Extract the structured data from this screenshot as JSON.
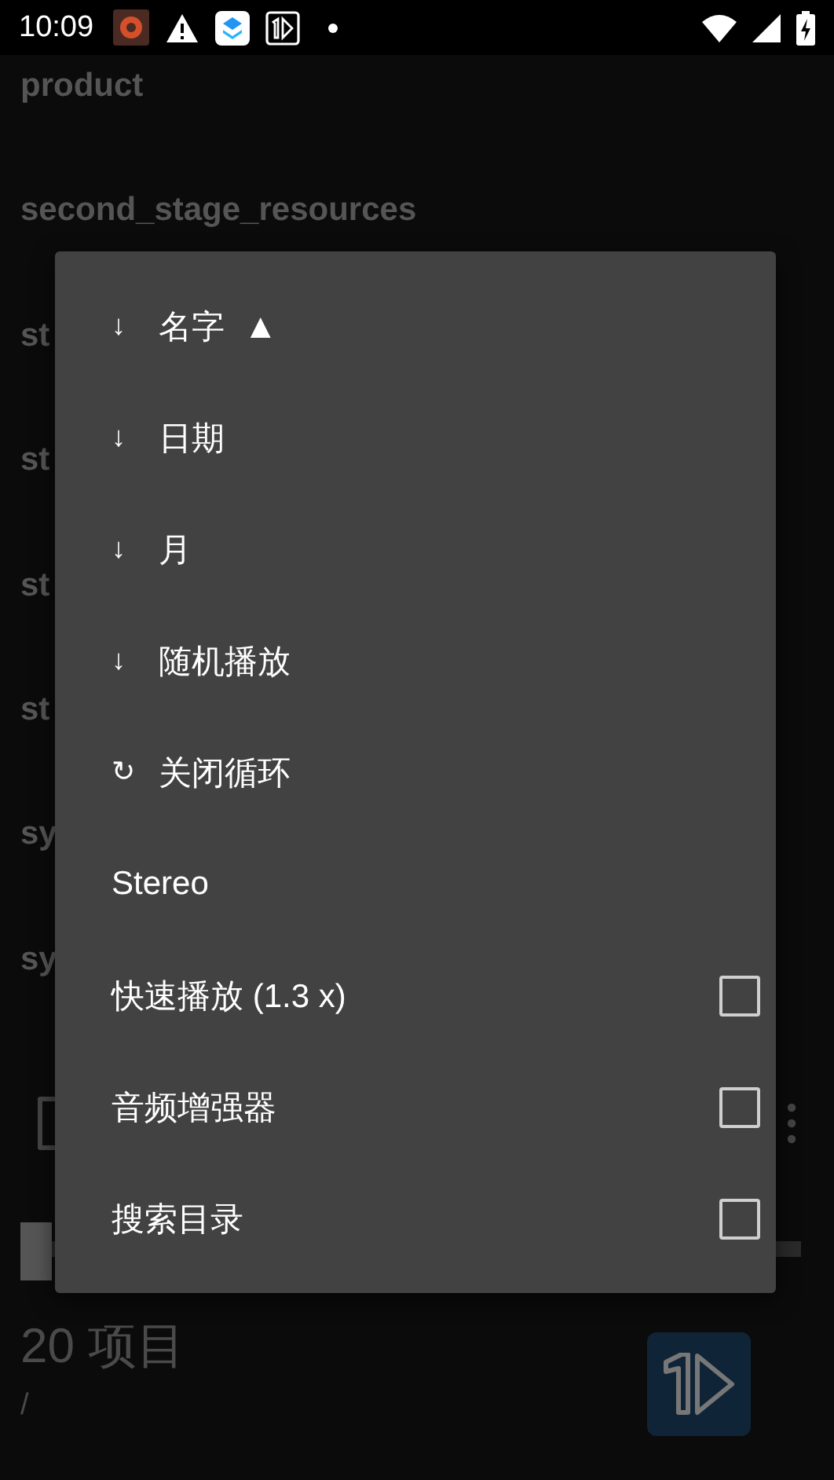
{
  "status_bar": {
    "time": "10:09"
  },
  "files": [
    {
      "name": "product"
    },
    {
      "name": "second_stage_resources"
    },
    {
      "name": "st"
    },
    {
      "name": "st"
    },
    {
      "name": "st"
    },
    {
      "name": "st"
    },
    {
      "name": "sy"
    },
    {
      "name": "sy"
    }
  ],
  "toolbar": {
    "select_all_checked": false
  },
  "seek_bar": {
    "level": 0
  },
  "footer": {
    "count": "20 项目",
    "path": "/"
  },
  "menu": {
    "items": [
      {
        "kind": "sort",
        "icon": "↓",
        "label": "名字",
        "indicator": "▲"
      },
      {
        "kind": "sort",
        "icon": "↓",
        "label": "日期"
      },
      {
        "kind": "sort",
        "icon": "↓",
        "label": "月"
      },
      {
        "kind": "sort",
        "icon": "↓",
        "label": "随机播放"
      },
      {
        "kind": "sort",
        "icon": "↻",
        "label": "关闭循环"
      },
      {
        "kind": "plain",
        "label": "Stereo"
      },
      {
        "kind": "check",
        "label": "快速播放 (1.3 x)",
        "checked": false
      },
      {
        "kind": "check",
        "label": "音频增强器",
        "checked": false
      },
      {
        "kind": "check",
        "label": "搜索目录",
        "checked": false
      }
    ]
  }
}
